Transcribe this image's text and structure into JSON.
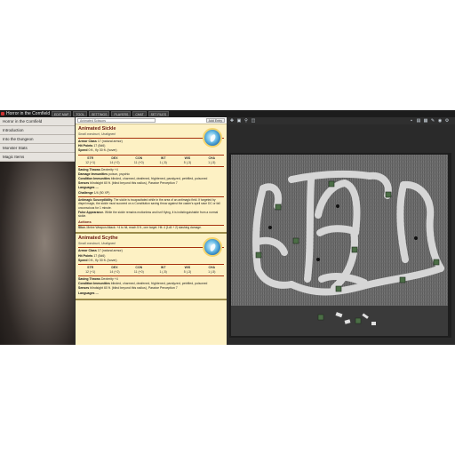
{
  "app": {
    "title": "Horror in the Cornfield"
  },
  "topbar": {
    "tabs": [
      "EDIT MAP",
      "TOOL",
      "SETTINGS",
      "PLAYERS",
      "CHAT",
      "SET FILES"
    ]
  },
  "leftnav": {
    "items": [
      "Horror in the Cornfield",
      "Introduction",
      "Into the Dungeon",
      "Monster Stats",
      "Magic Items"
    ]
  },
  "panel": {
    "search_placeholder": "Animated Scissors",
    "popout_label": "Add Entry"
  },
  "monsters": [
    {
      "name": "Animated Sickle",
      "type": "Small construct, Unaligned",
      "armor": {
        "label": "Armor Class",
        "value": "17 (natural armor)"
      },
      "hp": {
        "label": "Hit Points",
        "value": "17 (5d6)"
      },
      "speed": {
        "label": "Speed",
        "value": "0 ft., fly 30 ft. (hover)"
      },
      "abilities": [
        {
          "name": "STR",
          "value": "12 (+1)"
        },
        {
          "name": "DEX",
          "value": "14 (+2)"
        },
        {
          "name": "CON",
          "value": "11 (+0)"
        },
        {
          "name": "INT",
          "value": "1 (-5)"
        },
        {
          "name": "WIS",
          "value": "5 (-3)"
        },
        {
          "name": "CHA",
          "value": "1 (-5)"
        }
      ],
      "saves": {
        "label": "Saving Throws",
        "value": "Dexterity +4"
      },
      "dmg_imm": {
        "label": "Damage Immunities",
        "value": "poison, psychic"
      },
      "cond_imm": {
        "label": "Condition Immunities",
        "value": "blinded, charmed, deafened, frightened, paralyzed, petrified, poisoned"
      },
      "senses": {
        "label": "Senses",
        "value": "blindsight 60 ft. (blind beyond this radius), Passive Perception 7"
      },
      "languages": {
        "label": "Languages",
        "value": "—"
      },
      "challenge": {
        "label": "Challenge",
        "value": "1/4 (50 XP)"
      },
      "traits": [
        {
          "name": "Antimagic Susceptibility.",
          "text": "The sickle is incapacitated while in the area of an antimagic field. If targeted by dispel magic, the sickle must succeed on a Constitution saving throw against the caster's spell save DC or fall unconscious for 1 minute."
        },
        {
          "name": "False Appearance.",
          "text": "While the sickle remains motionless and isn't flying, it is indistinguishable from a normal sickle."
        }
      ],
      "actions_title": "Actions",
      "actions": [
        {
          "name": "Slice.",
          "text": "Melee Weapon Attack: +4 to hit, reach 5 ft., one target. Hit: 4 (1d4 + 2) slashing damage."
        }
      ]
    },
    {
      "name": "Animated Scythe",
      "type": "Small construct, Unaligned",
      "armor": {
        "label": "Armor Class",
        "value": "17 (natural armor)"
      },
      "hp": {
        "label": "Hit Points",
        "value": "17 (5d6)"
      },
      "speed": {
        "label": "Speed",
        "value": "0 ft., fly 30 ft. (hover)"
      },
      "abilities": [
        {
          "name": "STR",
          "value": "12 (+1)"
        },
        {
          "name": "DEX",
          "value": "14 (+2)"
        },
        {
          "name": "CON",
          "value": "11 (+0)"
        },
        {
          "name": "INT",
          "value": "1 (-5)"
        },
        {
          "name": "WIS",
          "value": "5 (-3)"
        },
        {
          "name": "CHA",
          "value": "1 (-5)"
        }
      ],
      "saves": {
        "label": "Saving Throws",
        "value": "Dexterity +4"
      },
      "cond_imm": {
        "label": "Condition Immunities",
        "value": "blinded, charmed, deafened, frightened, paralyzed, petrified, poisoned"
      },
      "senses": {
        "label": "Senses",
        "value": "blindsight 60 ft. (blind beyond this radius), Passive Perception 7"
      },
      "languages": {
        "label": "Languages",
        "value": "—"
      }
    }
  ],
  "map": {
    "tools": [
      "select-icon",
      "layers-icon",
      "zoom-icon",
      "measure-icon"
    ],
    "right_tools": [
      "token-icon",
      "image-icon",
      "grid-icon",
      "draw-icon",
      "eye-icon",
      "gear-icon"
    ],
    "colors": {
      "corn": "#5a5a5a",
      "path": "#d8d8d8",
      "token": "#4c6e46",
      "wall": "#1e1e1e"
    }
  }
}
